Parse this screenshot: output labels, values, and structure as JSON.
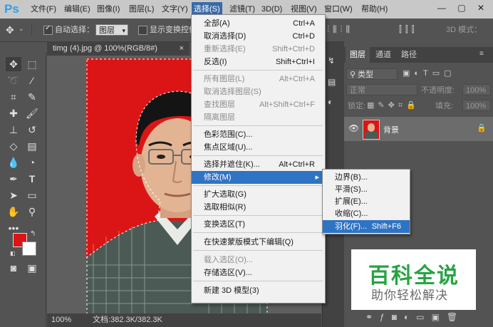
{
  "app": {
    "logo": "Ps"
  },
  "menubar": [
    {
      "label": "文件(F)",
      "active": false
    },
    {
      "label": "编辑(E)",
      "active": false
    },
    {
      "label": "图像(I)",
      "active": false
    },
    {
      "label": "图层(L)",
      "active": false
    },
    {
      "label": "文字(Y)",
      "active": false
    },
    {
      "label": "选择(S)",
      "active": true
    },
    {
      "label": "滤镜(T)",
      "active": false
    },
    {
      "label": "3D(D)",
      "active": false
    },
    {
      "label": "视图(V)",
      "active": false
    },
    {
      "label": "窗口(W)",
      "active": false
    },
    {
      "label": "帮助(H)",
      "active": false
    }
  ],
  "window_controls": [
    "—",
    "▢",
    "✕"
  ],
  "options": {
    "auto_select_label": "自动选择：",
    "auto_select_checked": true,
    "auto_select_value": "图层",
    "show_transform_label": "显示变换控件",
    "mode_3d_label": "3D 模式："
  },
  "document": {
    "tab_title": "timg (4).jpg @ 100%(RGB/8#)",
    "zoom": "100%",
    "doc_info": "文档:382.3K/382.3K"
  },
  "select_menu": [
    {
      "label": "全部(A)",
      "shortcut": "Ctrl+A",
      "enabled": true
    },
    {
      "label": "取消选择(D)",
      "shortcut": "Ctrl+D",
      "enabled": true
    },
    {
      "label": "重新选择(E)",
      "shortcut": "Shift+Ctrl+D",
      "enabled": false
    },
    {
      "label": "反选(I)",
      "shortcut": "Shift+Ctrl+I",
      "enabled": true
    },
    {
      "sep": true
    },
    {
      "label": "所有图层(L)",
      "shortcut": "Alt+Ctrl+A",
      "enabled": false
    },
    {
      "label": "取消选择图层(S)",
      "shortcut": "",
      "enabled": false
    },
    {
      "label": "查找图层",
      "shortcut": "Alt+Shift+Ctrl+F",
      "enabled": false
    },
    {
      "label": "隔离图层",
      "shortcut": "",
      "enabled": false
    },
    {
      "sep": true
    },
    {
      "label": "色彩范围(C)...",
      "shortcut": "",
      "enabled": true
    },
    {
      "label": "焦点区域(U)...",
      "shortcut": "",
      "enabled": true
    },
    {
      "sep": true
    },
    {
      "label": "选择并遮住(K)...",
      "shortcut": "Alt+Ctrl+R",
      "enabled": true
    },
    {
      "label": "修改(M)",
      "shortcut": "",
      "enabled": true,
      "highlight": true,
      "submenu": true
    },
    {
      "sep": true
    },
    {
      "label": "扩大选取(G)",
      "shortcut": "",
      "enabled": true
    },
    {
      "label": "选取相似(R)",
      "shortcut": "",
      "enabled": true
    },
    {
      "sep": true
    },
    {
      "label": "变换选区(T)",
      "shortcut": "",
      "enabled": true
    },
    {
      "sep": true
    },
    {
      "label": "在快速蒙版模式下编辑(Q)",
      "shortcut": "",
      "enabled": true
    },
    {
      "sep": true
    },
    {
      "label": "载入选区(O)...",
      "shortcut": "",
      "enabled": false
    },
    {
      "label": "存储选区(V)...",
      "shortcut": "",
      "enabled": true
    },
    {
      "sep": true
    },
    {
      "label": "新建 3D 模型(3)",
      "shortcut": "",
      "enabled": true
    }
  ],
  "modify_submenu": [
    {
      "label": "边界(B)...",
      "shortcut": ""
    },
    {
      "label": "平滑(S)...",
      "shortcut": ""
    },
    {
      "label": "扩展(E)...",
      "shortcut": ""
    },
    {
      "label": "收缩(C)...",
      "shortcut": ""
    },
    {
      "label": "羽化(F)...",
      "shortcut": "Shift+F6",
      "highlight": true
    }
  ],
  "layers_panel": {
    "tabs": [
      "图层",
      "通道",
      "路径"
    ],
    "kind_filter": "类型",
    "blend_mode": "正常",
    "opacity_label": "不透明度:",
    "opacity_value": "100%",
    "lock_label": "锁定:",
    "fill_label": "填充:",
    "fill_value": "100%",
    "layer_name": "背景"
  },
  "watermark": {
    "title": "百科全说",
    "subtitle": "助你轻松解决"
  },
  "colors": {
    "background_red": "#db1515",
    "menu_highlight": "#2f73c4",
    "watermark_green": "#27a343"
  }
}
